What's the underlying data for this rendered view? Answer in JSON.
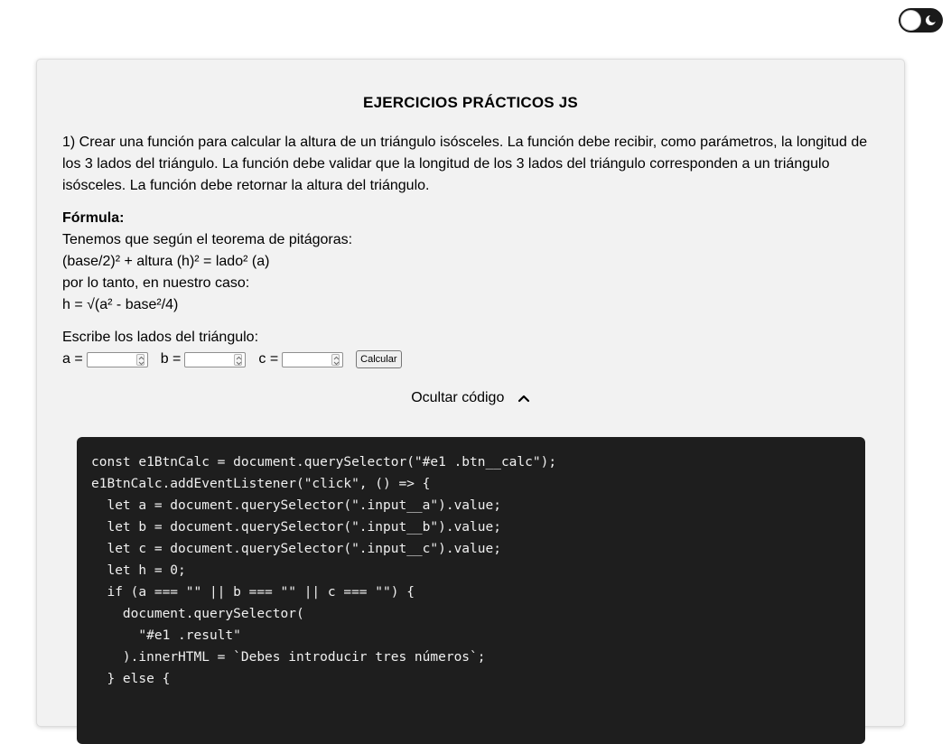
{
  "theme_toggle": {
    "icon": "moon-icon",
    "state": "light"
  },
  "exercise": {
    "title": "EJERCICIOS PRÁCTICOS JS",
    "description": "1) Crear una función para calcular la altura de un triángulo isósceles. La función debe recibir, como parámetros, la longitud de los 3 lados del triángulo. La función debe validar que la longitud de los 3 lados del triángulo corresponden a un triángulo isósceles. La función debe retornar la altura del triángulo.",
    "formula_label": "Fórmula:",
    "formula_lines": [
      "Tenemos que según el teorema de pitágoras:",
      "(base/2)² + altura (h)² = lado² (a)",
      "por lo tanto, en nuestro caso:",
      "h = √(a² - base²/4)"
    ],
    "inputs_prompt": "Escribe los lados del triángulo:",
    "inputs": [
      {
        "label": "a =",
        "value": ""
      },
      {
        "label": "b =",
        "value": ""
      },
      {
        "label": "c =",
        "value": ""
      }
    ],
    "calc_button": "Calcular",
    "toggle_code_label": "Ocultar código",
    "code_lines": [
      "const e1BtnCalc = document.querySelector(\"#e1 .btn__calc\");",
      "e1BtnCalc.addEventListener(\"click\", () => {",
      "  let a = document.querySelector(\".input__a\").value;",
      "  let b = document.querySelector(\".input__b\").value;",
      "  let c = document.querySelector(\".input__c\").value;",
      "  let h = 0;",
      "  if (a === \"\" || b === \"\" || c === \"\") {",
      "    document.querySelector(",
      "      \"#e1 .result\"",
      "    ).innerHTML = `Debes introducir tres números`;",
      "  } else {"
    ]
  },
  "colors": {
    "code_background": "#1e1e1e",
    "card_background": "#f2f2f2",
    "toggle_background": "#1a1a1a"
  }
}
